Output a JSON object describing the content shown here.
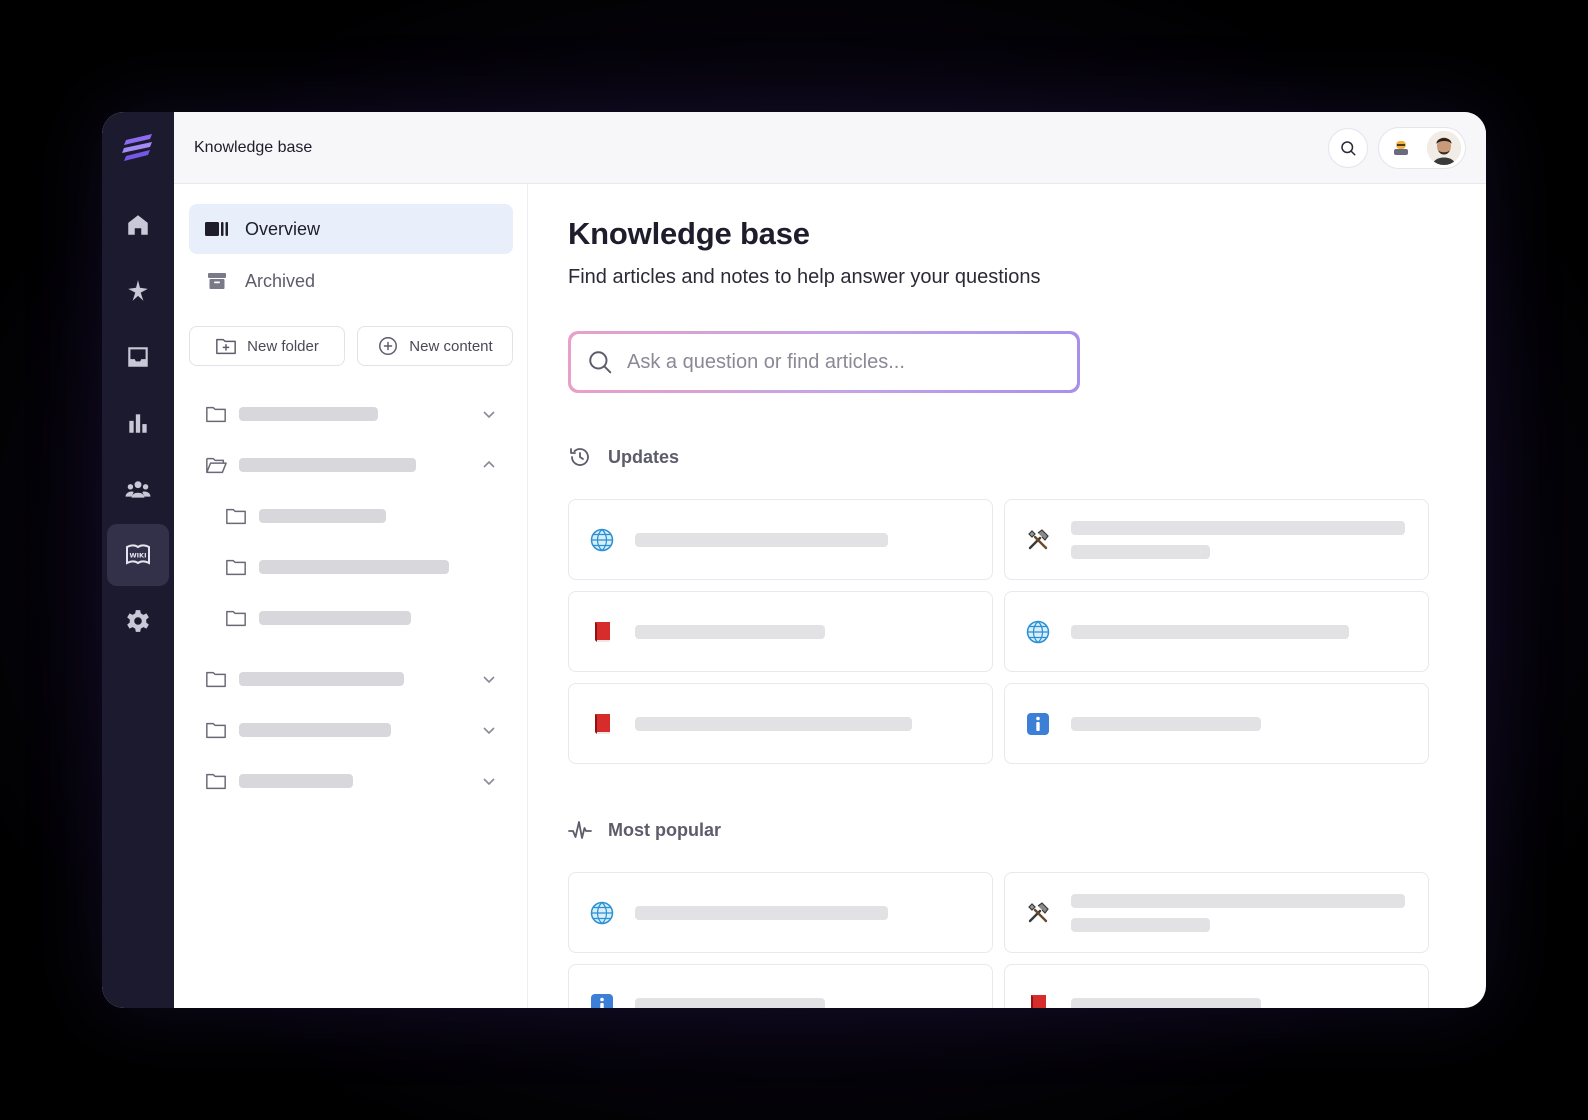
{
  "topbar": {
    "breadcrumb": "Knowledge base"
  },
  "rail": {
    "items": [
      {
        "icon": "home-icon"
      },
      {
        "icon": "sparkle-icon"
      },
      {
        "icon": "inbox-icon"
      },
      {
        "icon": "chart-icon"
      },
      {
        "icon": "team-icon"
      },
      {
        "icon": "wiki-icon",
        "label": "WIKI",
        "active": true
      },
      {
        "icon": "gear-icon"
      }
    ]
  },
  "side": {
    "nav": [
      {
        "label": "Overview",
        "icon": "columns-icon",
        "active": true
      },
      {
        "label": "Archived",
        "icon": "archive-icon",
        "active": false
      }
    ],
    "new_folder": "New folder",
    "new_content": "New content"
  },
  "main": {
    "title": "Knowledge base",
    "subtitle": "Find articles and notes to help answer your questions",
    "search_placeholder": "Ask a question or find articles...",
    "updates_heading": "Updates",
    "popular_heading": "Most popular"
  },
  "colors": {
    "rail_bg": "#1c1a2e",
    "accent_active": "#e9eefb",
    "search_gradient_start": "#e8a0c8",
    "search_gradient_end": "#a890ea"
  }
}
